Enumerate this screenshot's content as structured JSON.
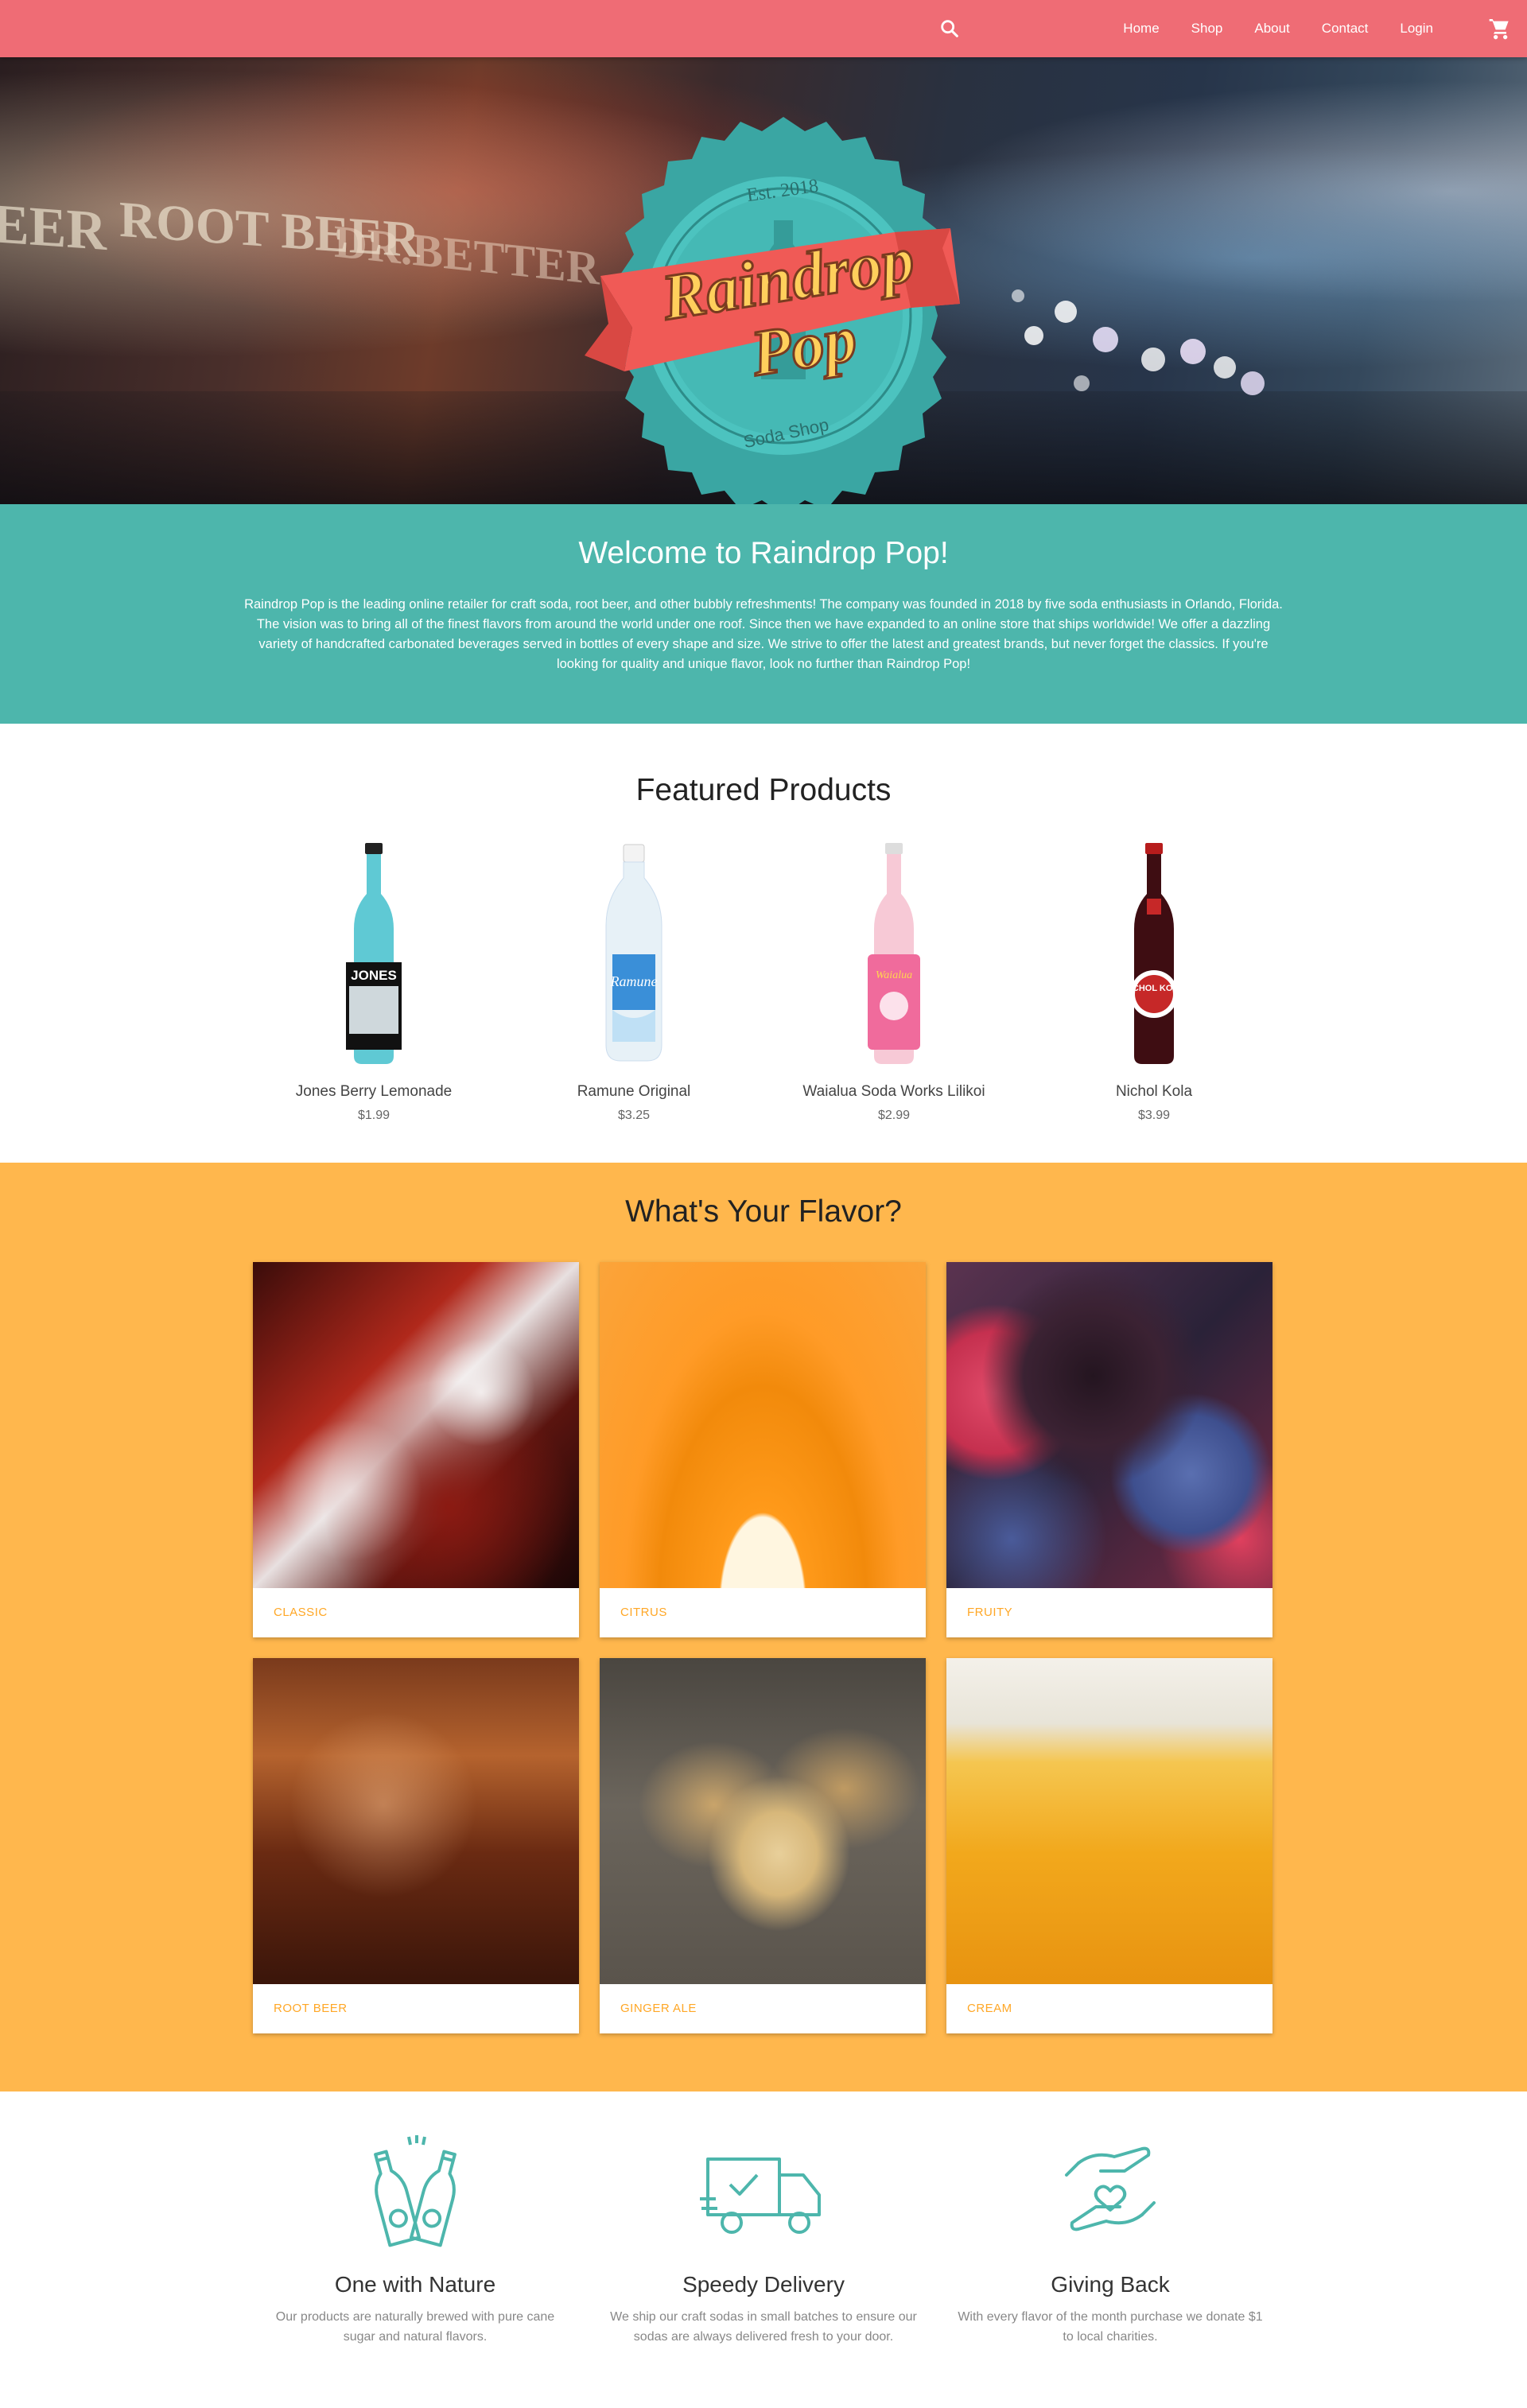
{
  "nav": {
    "items": [
      "Home",
      "Shop",
      "About",
      "Contact",
      "Login"
    ],
    "search_icon": "search-icon",
    "cart_icon": "cart-icon",
    "color": "#ef6c75"
  },
  "hero": {
    "logo_est": "Est. 2018",
    "logo_line1": "Raindrop",
    "logo_line2": "Pop",
    "logo_sub": "Soda Shop"
  },
  "welcome": {
    "title": "Welcome to Raindrop Pop!",
    "body": "Raindrop Pop is the leading online retailer for craft soda, root beer, and other bubbly refreshments! The company was founded in 2018 by five soda enthusiasts in Orlando, Florida. The vision was to bring all of the finest flavors from around the world under one roof. Since then we have expanded to an online store that ships worldwide! We offer a dazzling variety of handcrafted carbonated beverages served in bottles of every shape and size. We strive to offer the latest and greatest brands, but never forget the classics. If you're looking for quality and unique flavor, look no further than Raindrop Pop!",
    "color": "#4db6ac"
  },
  "featured": {
    "title": "Featured Products",
    "products": [
      {
        "name": "Jones Berry Lemonade",
        "price": "$1.99",
        "label": "JONES"
      },
      {
        "name": "Ramune Original",
        "price": "$3.25",
        "label": "Ramune"
      },
      {
        "name": "Waialua Soda Works Lilikoi",
        "price": "$2.99",
        "label": "Waialua"
      },
      {
        "name": "Nichol Kola",
        "price": "$3.99",
        "label": "NICHOL KOLA"
      }
    ]
  },
  "flavors": {
    "title": "What's Your Flavor?",
    "color": "#ffb74d",
    "caption_color": "#ffa726",
    "cards": [
      {
        "label": "CLASSIC"
      },
      {
        "label": "CITRUS"
      },
      {
        "label": "FRUITY"
      },
      {
        "label": "ROOT BEER"
      },
      {
        "label": "GINGER ALE"
      },
      {
        "label": "CREAM"
      }
    ]
  },
  "features": [
    {
      "title": "One with Nature",
      "body": "Our products are naturally brewed with pure cane sugar and natural flavors.",
      "icon": "soda-bottles-icon"
    },
    {
      "title": "Speedy Delivery",
      "body": "We ship our craft sodas in small batches to ensure our sodas are always delivered fresh to your door.",
      "icon": "delivery-truck-icon"
    },
    {
      "title": "Giving Back",
      "body": "With every flavor of the month purchase we donate $1 to local charities.",
      "icon": "giving-hands-icon"
    }
  ]
}
